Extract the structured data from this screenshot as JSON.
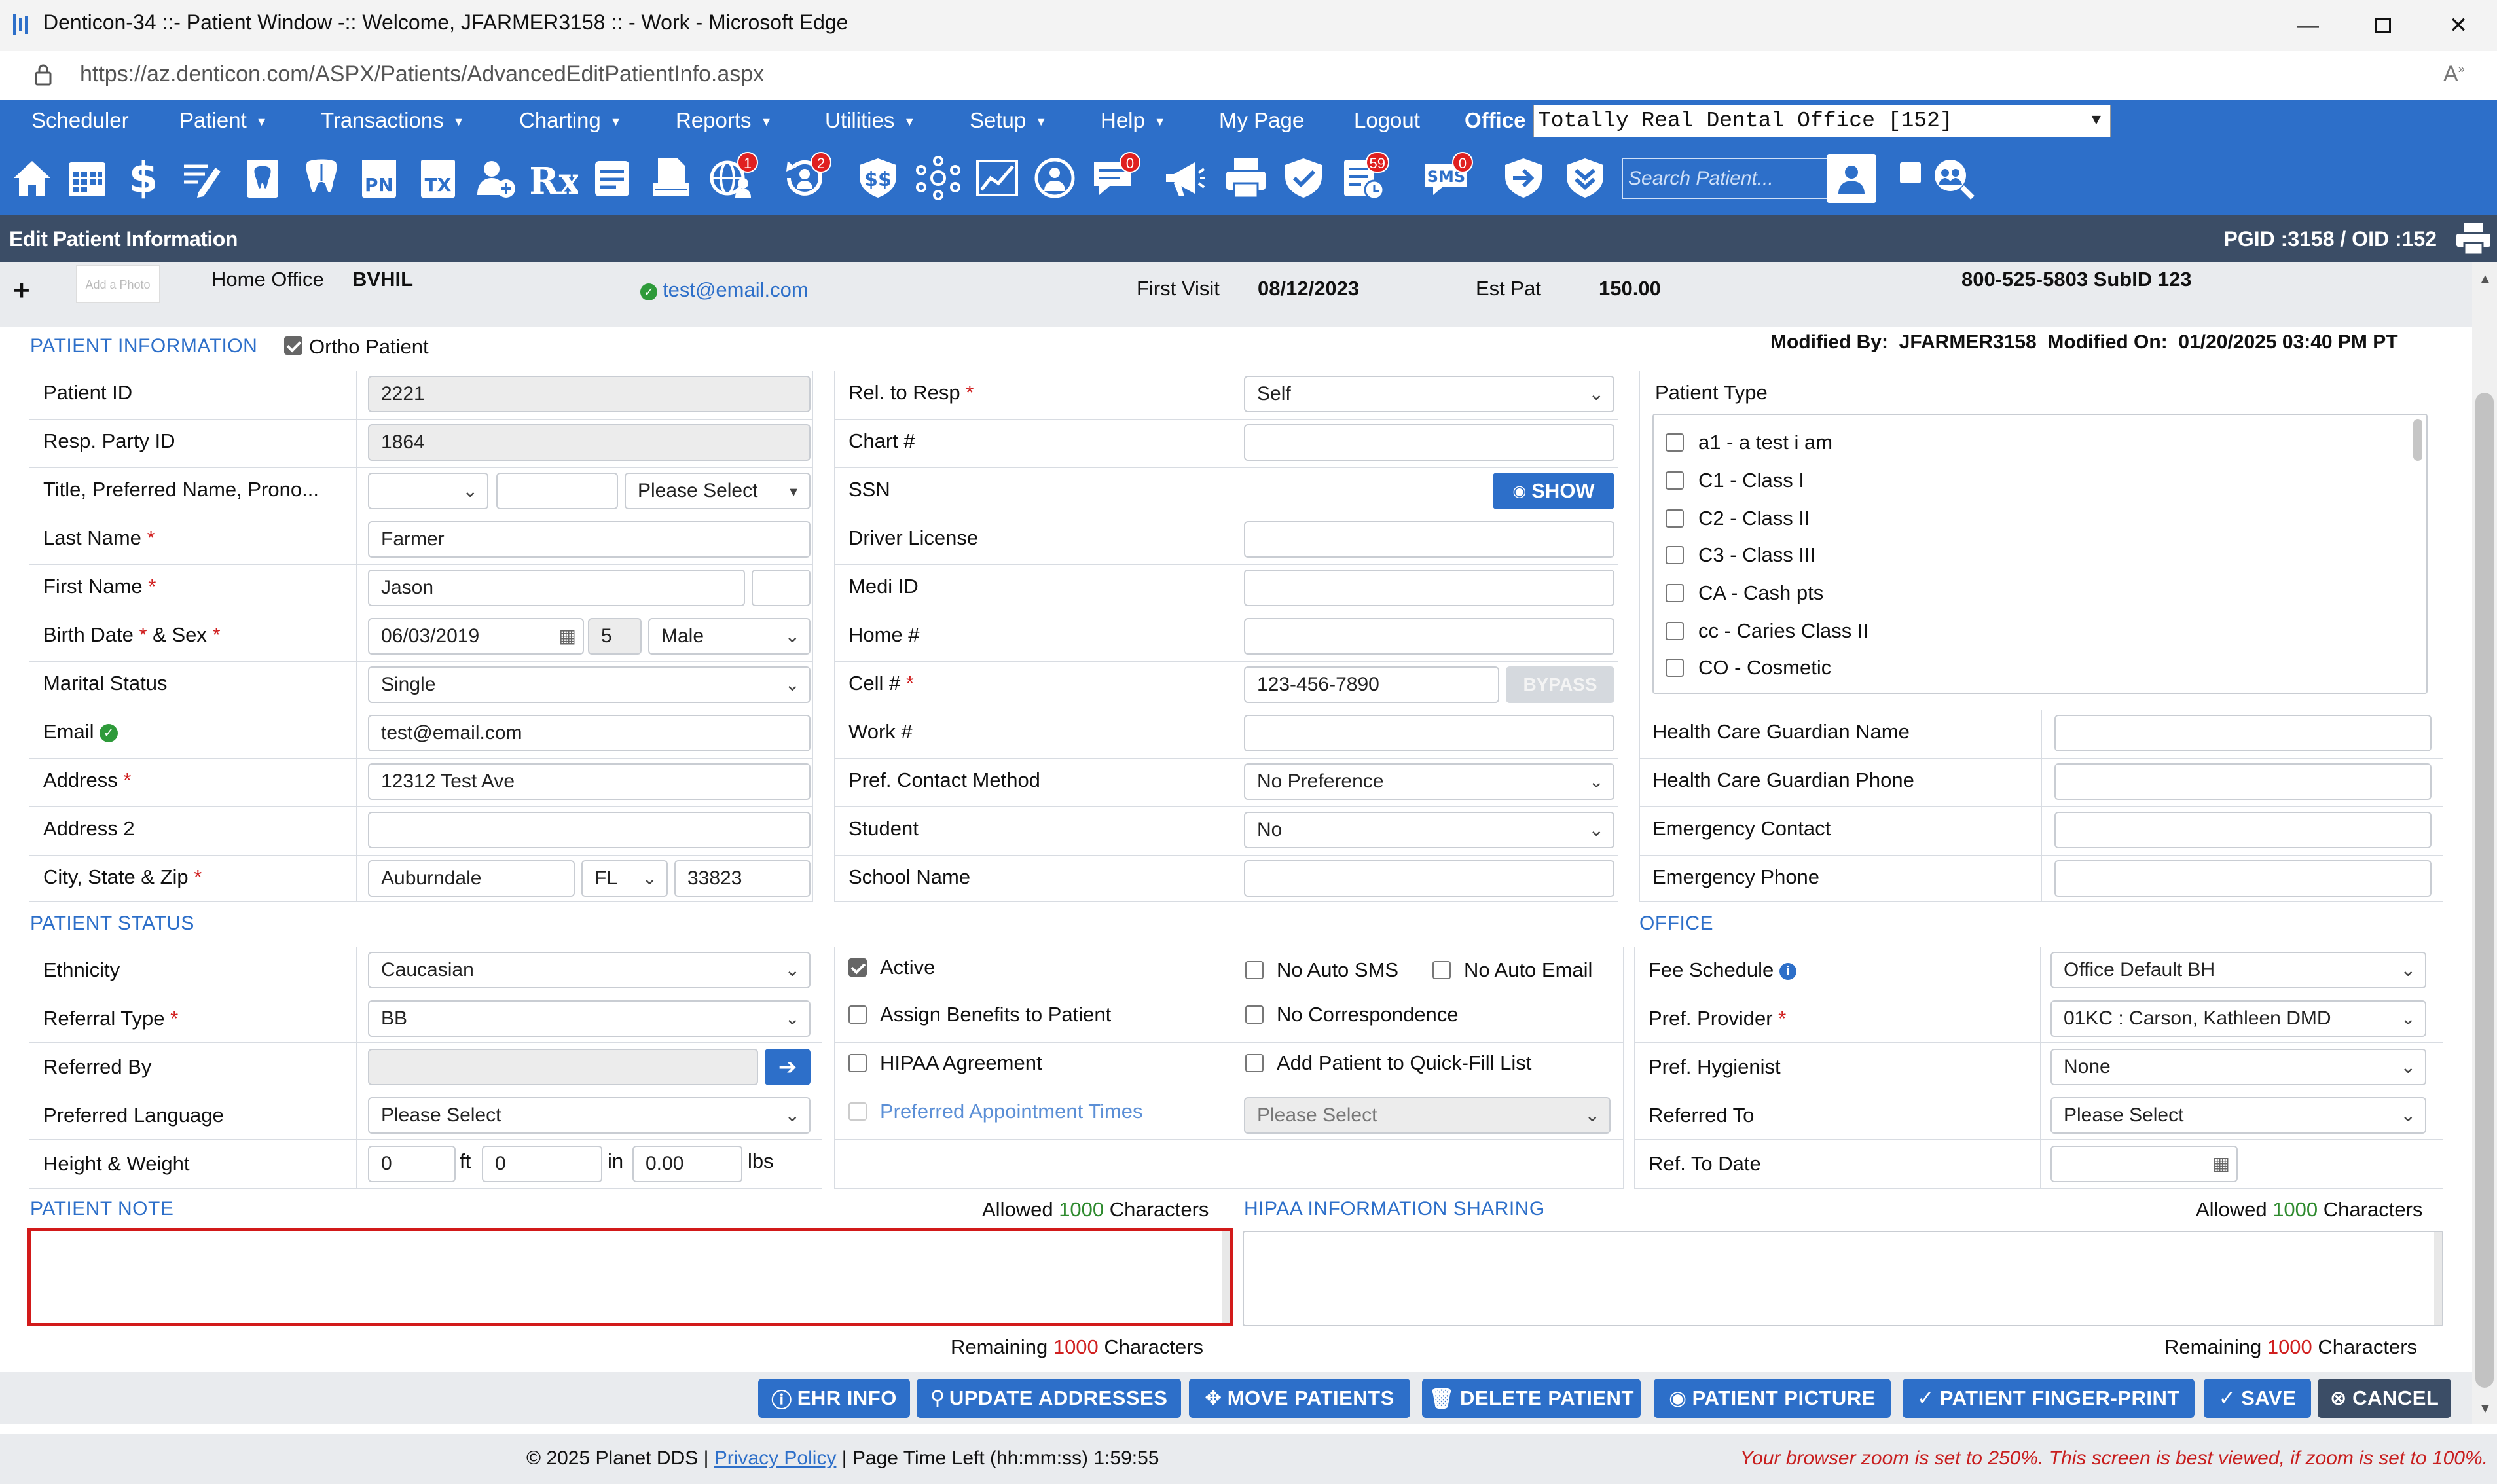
{
  "window": {
    "title": "Denticon-34 ::- Patient Window -:: Welcome, JFARMER3158 :: - Work - Microsoft Edge",
    "url_host": "https://az.denticon.com",
    "url_path": "/ASPX/Patients/AdvancedEditPatientInfo.aspx"
  },
  "menu": {
    "items": [
      "Scheduler",
      "Patient",
      "Transactions",
      "Charting",
      "Reports",
      "Utilities",
      "Setup",
      "Help",
      "My Page",
      "Logout"
    ],
    "office_label": "Office",
    "office_value": "Totally Real Dental Office [152]"
  },
  "toolbar": {
    "icons": [
      "home-icon",
      "calendar-icon",
      "dollar-icon",
      "edit-notes-icon",
      "tooth-chart-icon",
      "teeth-icon",
      "pn-icon",
      "tx-icon",
      "add-patient-icon",
      "rx-icon",
      "document-icon",
      "print-doc-icon",
      "globe-user-icon",
      "refresh-user-icon",
      "ss-dollar-icon",
      "network-icon",
      "chart-line-icon",
      "patient-globe-icon",
      "message-icon",
      "megaphone-icon",
      "printer-icon",
      "shield-check-icon",
      "checklist-icon",
      "sms-icon",
      "arrow-right-icon",
      "chevrons-down-icon"
    ],
    "badges": {
      "globe": "1",
      "refresh": "2",
      "message": "0",
      "checklist": "59",
      "sms": "0"
    },
    "search_placeholder": "Search Patient..."
  },
  "header": {
    "title": "Edit Patient Information",
    "ids": "PGID :3158  /  OID :152"
  },
  "info_strip": {
    "add_photo": "Add a Photo",
    "home_office_label": "Home Office",
    "home_office_value": "BVHIL",
    "email": "test@email.com",
    "first_visit_label": "First Visit",
    "first_visit_value": "08/12/2023",
    "est_pat_label": "Est Pat",
    "est_pat_value": "150.00",
    "phone": "800-525-5803 SubID 123"
  },
  "patient_info": {
    "section_title": "PATIENT INFORMATION",
    "ortho_label": "Ortho Patient",
    "modified": "Modified By:  JFARMER3158  Modified On:  01/20/2025 03:40 PM PT",
    "patient_id_label": "Patient ID",
    "patient_id": "2221",
    "resp_party_label": "Resp. Party ID",
    "resp_party": "1864",
    "title_label": "Title, Preferred Name, Prono...",
    "pronoun_value": "Please Select",
    "last_name_label": "Last Name",
    "last_name": "Farmer",
    "first_name_label": "First Name",
    "first_name": "Jason",
    "birth_label": "Birth Date",
    "sex_label": "& Sex",
    "birth_date": "06/03/2019",
    "age": "5",
    "sex": "Male",
    "marital_label": "Marital Status",
    "marital": "Single",
    "email_label": "Email",
    "email": "test@email.com",
    "address_label": "Address",
    "address": "12312 Test Ave",
    "address2_label": "Address 2",
    "address2": "",
    "csz_label": "City, State & Zip",
    "city": "Auburndale",
    "state": "FL",
    "zip": "33823",
    "rel_label": "Rel. to Resp",
    "rel": "Self",
    "chart_label": "Chart #",
    "ssn_label": "SSN",
    "show_btn": "SHOW",
    "dl_label": "Driver License",
    "medi_label": "Medi ID",
    "home_label": "Home #",
    "cell_label": "Cell #",
    "cell": "123-456-7890",
    "bypass_btn": "BYPASS",
    "work_label": "Work #",
    "pref_contact_label": "Pref. Contact Method",
    "pref_contact": "No Preference",
    "student_label": "Student",
    "student": "No",
    "school_label": "School Name",
    "patient_type_label": "Patient Type",
    "patient_types": [
      "a1 - a test i am",
      "C1 - Class I",
      "C2 - Class II",
      "C3 - Class III",
      "CA - Cash pts",
      "cc - Caries Class II",
      "CO - Cosmetic"
    ],
    "hcg_name_label": "Health Care Guardian Name",
    "hcg_phone_label": "Health Care Guardian Phone",
    "emerg_contact_label": "Emergency Contact",
    "emerg_phone_label": "Emergency Phone"
  },
  "patient_status": {
    "section_title": "PATIENT STATUS",
    "ethnicity_label": "Ethnicity",
    "ethnicity": "Caucasian",
    "referral_type_label": "Referral Type",
    "referral_type": "BB",
    "referred_by_label": "Referred By",
    "pref_lang_label": "Preferred Language",
    "pref_lang": "Please Select",
    "hw_label": "Height & Weight",
    "height_ft": "0",
    "ft": "ft",
    "height_in": "0",
    "in": "in",
    "weight": "0.00",
    "lbs": "lbs",
    "active": "Active",
    "assign_benefits": "Assign Benefits to Patient",
    "hipaa_agreement": "HIPAA Agreement",
    "pref_appt_times": "Preferred Appointment Times",
    "pref_appt_value": "Please Select",
    "no_auto_sms": "No Auto SMS",
    "no_auto_email": "No Auto Email",
    "no_correspondence": "No Correspondence",
    "quick_fill": "Add Patient to Quick-Fill List"
  },
  "office": {
    "section_title": "OFFICE",
    "fee_schedule_label": "Fee Schedule",
    "fee_schedule": "Office Default BH",
    "pref_provider_label": "Pref. Provider",
    "pref_provider": "01KC : Carson, Kathleen DMD",
    "pref_hygienist_label": "Pref. Hygienist",
    "pref_hygienist": "None",
    "referred_to_label": "Referred To",
    "referred_to": "Please Select",
    "ref_date_label": "Ref. To Date"
  },
  "notes": {
    "patient_note_title": "PATIENT NOTE",
    "hipaa_title": "HIPAA INFORMATION SHARING",
    "allowed_prefix": "Allowed",
    "allowed_count": "1000",
    "allowed_suffix": "Characters",
    "remaining_prefix": "Remaining",
    "remaining_count": "1000",
    "remaining_suffix": "Characters"
  },
  "buttons": [
    "EHR INFO",
    "UPDATE ADDRESSES",
    "MOVE PATIENTS",
    "DELETE PATIENT",
    "PATIENT PICTURE",
    "PATIENT FINGER-PRINT",
    "SAVE",
    "CANCEL"
  ],
  "footer": {
    "copyright": "© 2025 Planet DDS |",
    "privacy": "Privacy Policy",
    "time_left": "| Page Time Left (hh:mm:ss) 1:59:55",
    "zoom_warning": "Your browser zoom is set to 250%. This screen is best viewed, if zoom is set to 100%."
  },
  "colors": {
    "brand_blue": "#2d6fc9",
    "header_dark": "#3b4d66",
    "required_red": "#d02020",
    "count_green": "#2e8a2e"
  }
}
